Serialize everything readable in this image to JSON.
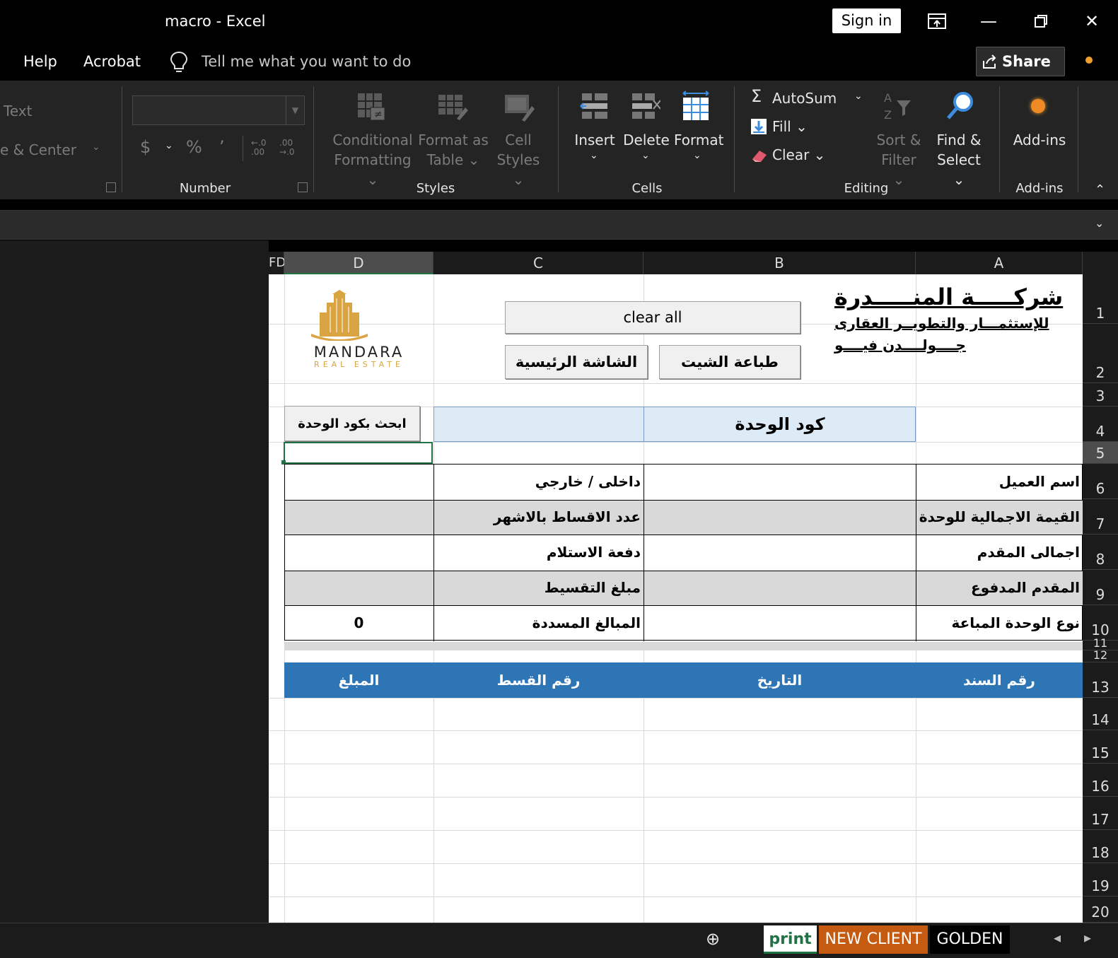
{
  "window": {
    "title": "macro  -  Excel",
    "sign_in": "Sign in",
    "minimize": "—",
    "restore": "❐",
    "close": "✕",
    "ribbon_display": "⬚"
  },
  "menu": {
    "items": [
      "Help",
      "Acrobat"
    ],
    "tell_me": "Tell me what you want to do",
    "share": "Share"
  },
  "ribbon": {
    "alignment": {
      "wrap_text": "Text",
      "merge_center": "e & Center"
    },
    "number": {
      "label": "Number",
      "currency": "$",
      "percent": "%",
      "comma": "’",
      "inc_dec": "←.0\n.00",
      "dec_dec": ".00\n→.0"
    },
    "styles": {
      "label": "Styles",
      "conditional": [
        "Conditional",
        "Formatting ⌄"
      ],
      "format_table": [
        "Format as",
        "Table ⌄"
      ],
      "cell_styles": [
        "Cell",
        "Styles ⌄"
      ]
    },
    "cells": {
      "label": "Cells",
      "insert": "Insert",
      "delete": "Delete",
      "format": "Format"
    },
    "editing": {
      "label": "Editing",
      "autosum": "AutoSum",
      "fill": "Fill ⌄",
      "clear": "Clear ⌄",
      "sort": [
        "Sort &",
        "Filter ⌄"
      ],
      "find": [
        "Find &",
        "Select ⌄"
      ]
    },
    "addins": {
      "label": "Add-ins",
      "button": "Add-ins"
    }
  },
  "grid": {
    "columns": [
      "D",
      "C",
      "B",
      "A"
    ],
    "partial_col": "FD",
    "rows": [
      "1",
      "2",
      "3",
      "4",
      "5",
      "6",
      "7",
      "8",
      "9",
      "10",
      "11",
      "12",
      "13",
      "14",
      "15",
      "16",
      "17",
      "18",
      "19",
      "20"
    ]
  },
  "sheet": {
    "company": {
      "line1": "شركـــــة المنـــــدرة",
      "line2": "للإستثمـــار والتطويــر العقارى",
      "line3": "جــــولــــدن فيــــو"
    },
    "logo": {
      "name": "MANDARA",
      "sub": "REAL ESTATE"
    },
    "buttons": {
      "clear_all": "clear all",
      "home": "الشاشة الرئيسية",
      "print": "طباعة الشيت",
      "search": "ابحث بكود الوحدة"
    },
    "unit_code_label": "كود الوحدة",
    "info_rows": [
      {
        "a": "اسم العميل",
        "c": "داخلى / خارجي",
        "d": ""
      },
      {
        "a": "القيمة الاجمالية للوحدة",
        "c": "عدد الاقساط بالاشهر",
        "d": ""
      },
      {
        "a": "اجمالى المقدم",
        "c": "دفعة الاستلام",
        "d": ""
      },
      {
        "a": "المقدم المدفوع",
        "c": "مبلغ التقسيط",
        "d": ""
      },
      {
        "a": "نوع الوحدة المباعة",
        "c": "المبالغ المسددة",
        "d": "0"
      }
    ],
    "table_headers": {
      "a": "رقم السند",
      "b": "التاريخ",
      "c": "رقم القسط",
      "d": "المبلغ"
    }
  },
  "tabs": {
    "add": "⊕",
    "items": [
      "print",
      "NEW CLIENT",
      "GOLDEN"
    ],
    "nav_left": "◂",
    "nav_right": "▸"
  },
  "colors": {
    "accent_blue": "#2e75b6",
    "light_blue": "#ddebf7",
    "grey_row": "#d9d9d9",
    "tab_orange": "#c55a11",
    "tab_green_text": "#217346",
    "logo_gold": "#d9a441"
  }
}
